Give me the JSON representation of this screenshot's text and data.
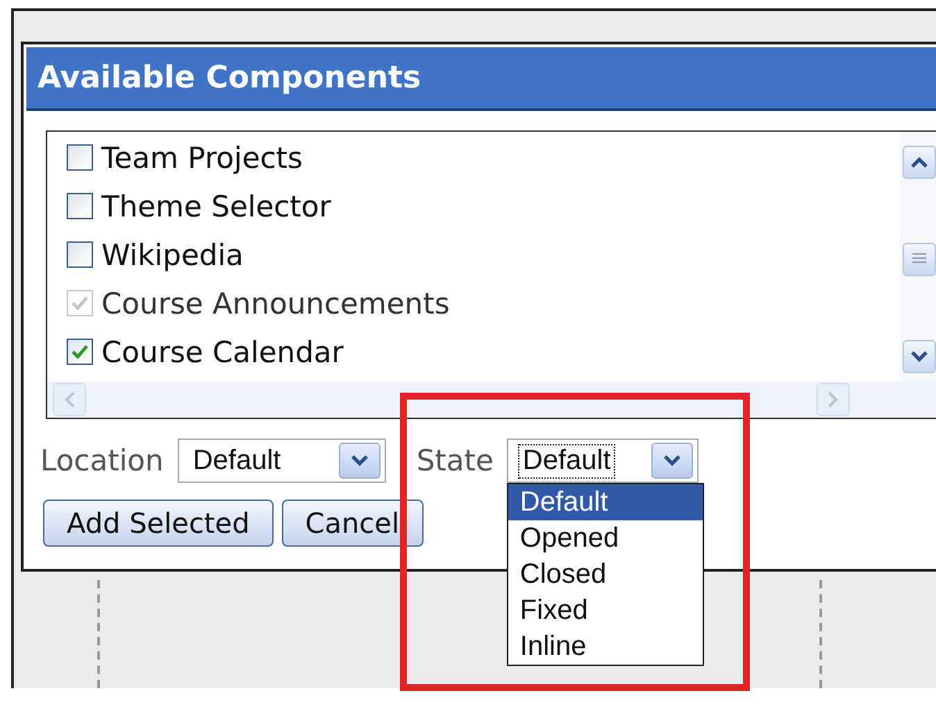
{
  "dialog": {
    "title": "Available Components",
    "components": [
      {
        "label": "Team Projects",
        "checked": false,
        "disabled": false
      },
      {
        "label": "Theme Selector",
        "checked": false,
        "disabled": false
      },
      {
        "label": "Wikipedia",
        "checked": false,
        "disabled": false
      },
      {
        "label": "Course Announcements",
        "checked": true,
        "disabled": true
      },
      {
        "label": "Course Calendar",
        "checked": true,
        "disabled": false
      }
    ],
    "location": {
      "label": "Location",
      "value": "Default"
    },
    "state": {
      "label": "State",
      "value": "Default",
      "expanded": true,
      "options": [
        {
          "label": "Default",
          "selected": true
        },
        {
          "label": "Opened",
          "selected": false
        },
        {
          "label": "Closed",
          "selected": false
        },
        {
          "label": "Fixed",
          "selected": false
        },
        {
          "label": "Inline",
          "selected": false
        }
      ]
    },
    "buttons": [
      "Add Selected",
      "Cancel"
    ]
  }
}
